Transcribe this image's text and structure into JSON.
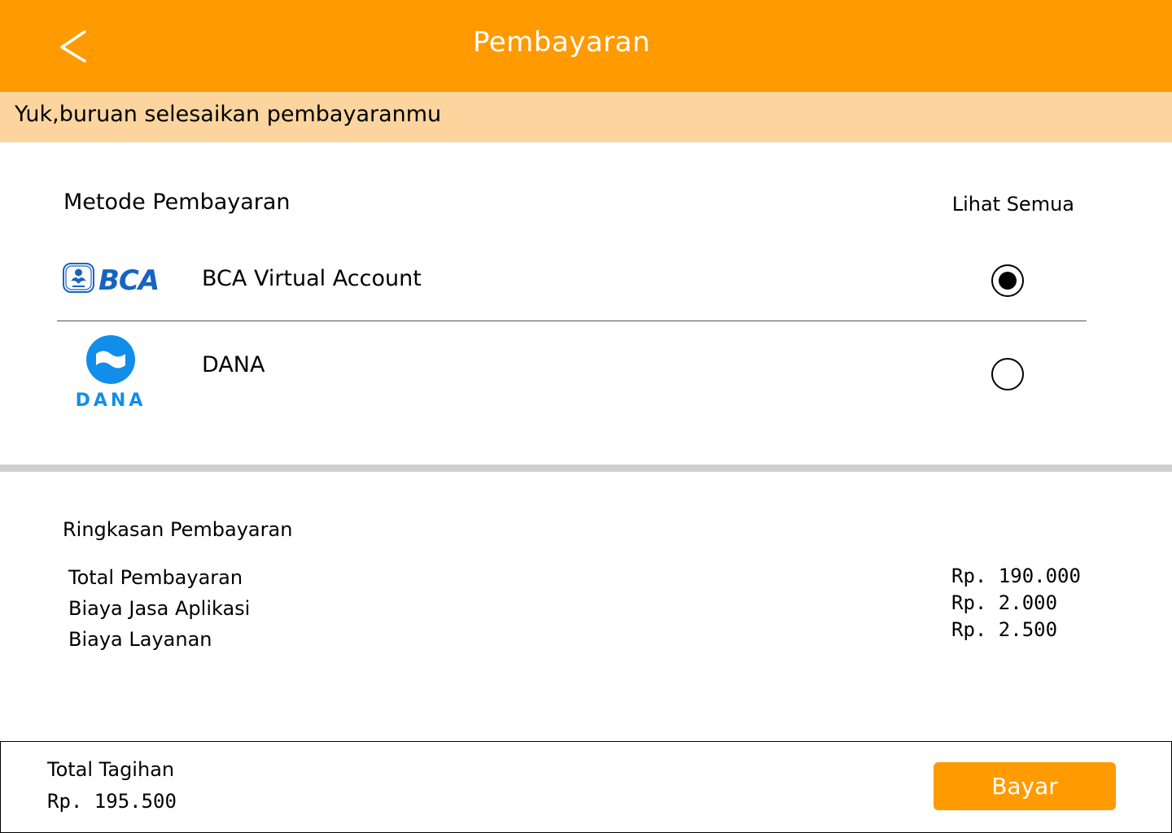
{
  "colors": {
    "accent": "#FF9A00",
    "banner": "#FCD59E",
    "divider": "#CFCFCF",
    "bca_blue": "#1565C0",
    "dana_blue": "#118EEA"
  },
  "header": {
    "back_icon": "chevron-left-icon",
    "title": "Pembayaran"
  },
  "banner": {
    "text": "Yuk,buruan selesaikan pembayaranmu"
  },
  "payment_methods": {
    "title": "Metode Pembayaran",
    "see_all_label": "Lihat Semua",
    "items": [
      {
        "logo": "bca-logo",
        "logo_text": "BCA",
        "label": "BCA Virtual Account",
        "selected": true
      },
      {
        "logo": "dana-logo",
        "logo_text": "DANA",
        "label": "DANA",
        "selected": false
      }
    ]
  },
  "summary": {
    "title": "Ringkasan Pembayaran",
    "rows": [
      {
        "label": "Total Pembayaran",
        "value": "Rp. 190.000"
      },
      {
        "label": "Biaya Jasa Aplikasi",
        "value": "Rp. 2.000"
      },
      {
        "label": "Biaya Layanan",
        "value": "Rp. 2.500"
      }
    ]
  },
  "footer": {
    "total_label": "Total Tagihan",
    "total_value": "Rp. 195.500",
    "pay_button_label": "Bayar"
  }
}
